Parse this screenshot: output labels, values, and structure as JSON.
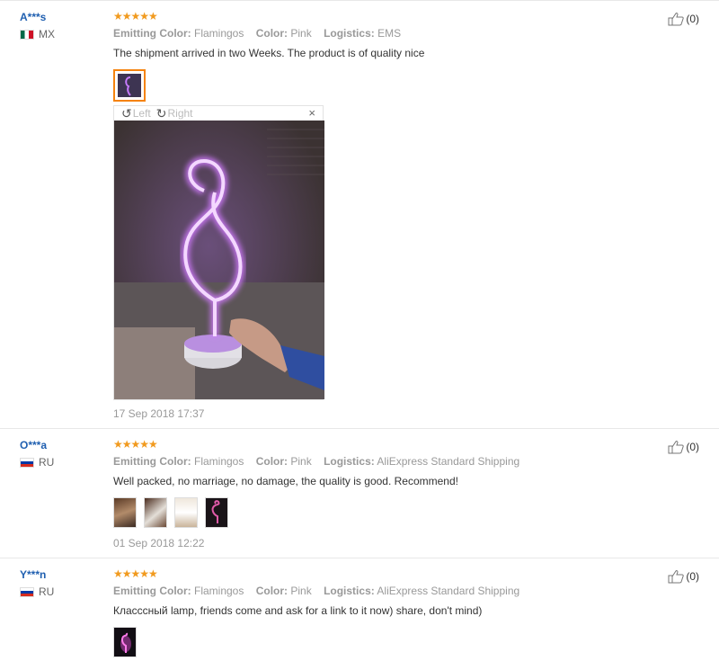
{
  "labels": {
    "emitting_color": "Emitting Color:",
    "color": "Color:",
    "logistics": "Logistics:"
  },
  "viewer": {
    "left_label": "Left",
    "right_label": "Right",
    "close": "×"
  },
  "reviews": [
    {
      "user": "A***s",
      "country": "MX",
      "stars": "★★★★★",
      "emitting_color": "Flamingos",
      "color": "Pink",
      "logistics": "EMS",
      "text": "The shipment arrived in two Weeks. The product is of quality nice",
      "date": "17 Sep 2018 17:37",
      "helpful": "(0)"
    },
    {
      "user": "O***a",
      "country": "RU",
      "stars": "★★★★★",
      "emitting_color": "Flamingos",
      "color": "Pink",
      "logistics": "AliExpress Standard Shipping",
      "text": "Well packed, no marriage, no damage, the quality is good. Recommend!",
      "date": "01 Sep 2018 12:22",
      "helpful": "(0)"
    },
    {
      "user": "Y***n",
      "country": "RU",
      "stars": "★★★★★",
      "emitting_color": "Flamingos",
      "color": "Pink",
      "logistics": "AliExpress Standard Shipping",
      "text": "Классcный lamp, friends come and ask for a link to it now) share, don't mind)",
      "helpful": "(0)"
    }
  ]
}
